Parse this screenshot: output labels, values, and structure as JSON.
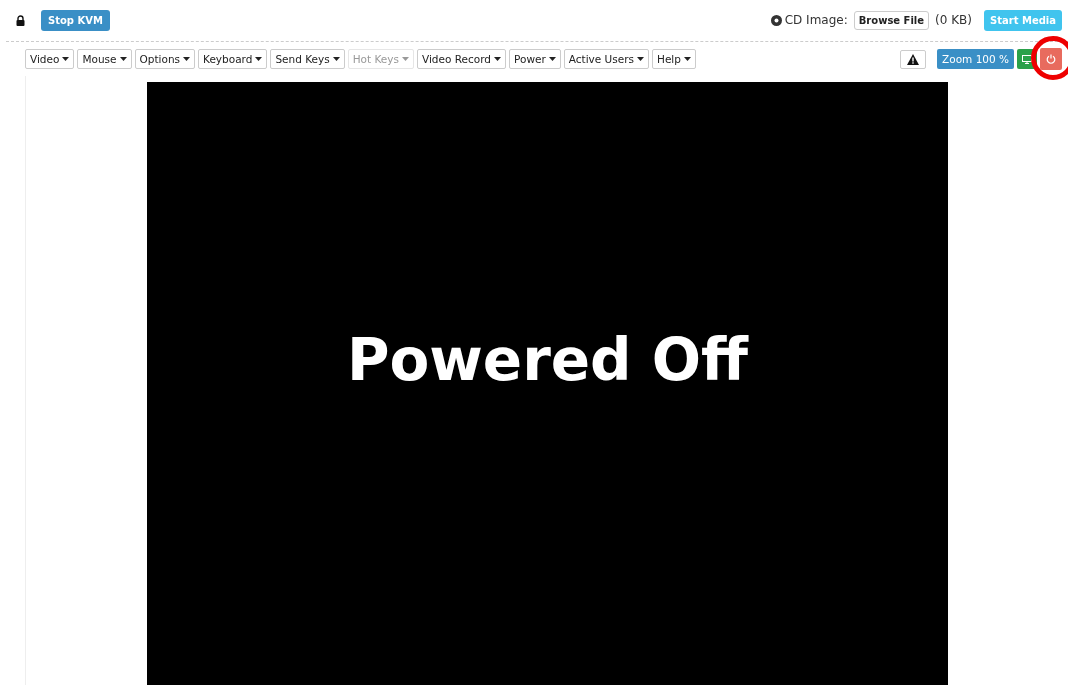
{
  "top_bar": {
    "stop_button": "Stop KVM",
    "cd_label": "CD Image:",
    "browse_button": "Browse File",
    "file_size": "(0 KB)",
    "start_button": "Start Media"
  },
  "menus": [
    {
      "label": "Video",
      "disabled": false
    },
    {
      "label": "Mouse",
      "disabled": false
    },
    {
      "label": "Options",
      "disabled": false
    },
    {
      "label": "Keyboard",
      "disabled": false
    },
    {
      "label": "Send Keys",
      "disabled": false
    },
    {
      "label": "Hot Keys",
      "disabled": true
    },
    {
      "label": "Video Record",
      "disabled": false
    },
    {
      "label": "Power",
      "disabled": false
    },
    {
      "label": "Active Users",
      "disabled": false
    },
    {
      "label": "Help",
      "disabled": false
    }
  ],
  "zoom_button": "Zoom 100 %",
  "screen": {
    "message": "Powered Off"
  }
}
